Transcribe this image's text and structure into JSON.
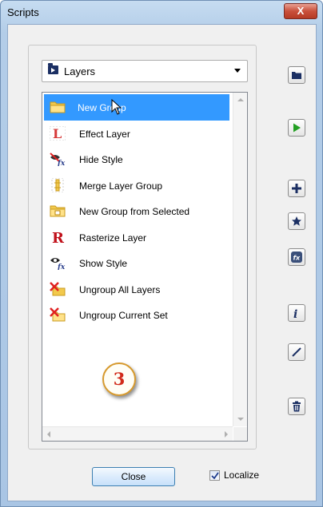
{
  "window": {
    "title": "Scripts",
    "close_glyph": "X"
  },
  "dropdown": {
    "selected": "Layers",
    "icon": "folder-script-icon"
  },
  "script_list": {
    "items": [
      {
        "label": "New Group",
        "icon": "folder-icon",
        "selected": true
      },
      {
        "label": "Effect Layer",
        "icon": "effect-layer-icon"
      },
      {
        "label": "Hide Style",
        "icon": "hide-style-fx-icon"
      },
      {
        "label": "Merge Layer Group",
        "icon": "merge-layer-group-icon"
      },
      {
        "label": "New Group from Selected",
        "icon": "folder-from-selected-icon"
      },
      {
        "label": "Rasterize Layer",
        "icon": "rasterize-r-icon"
      },
      {
        "label": "Show Style",
        "icon": "show-style-eye-fx-icon"
      },
      {
        "label": "Ungroup All Layers",
        "icon": "ungroup-all-icon"
      },
      {
        "label": "Ungroup Current Set",
        "icon": "ungroup-current-icon"
      }
    ]
  },
  "callout": {
    "number": "3"
  },
  "side_buttons": [
    {
      "name": "open-folder-button",
      "icon": "folder-icon"
    },
    {
      "name": "run-script-button",
      "icon": "play-icon"
    },
    {
      "name": "add-script-button",
      "icon": "plus-icon"
    },
    {
      "name": "favorite-button",
      "icon": "star-icon"
    },
    {
      "name": "fx-button",
      "icon": "fx-icon"
    },
    {
      "name": "info-button",
      "icon": "info-icon"
    },
    {
      "name": "edit-button",
      "icon": "pencil-icon"
    },
    {
      "name": "delete-button",
      "icon": "trash-icon"
    }
  ],
  "footer": {
    "close_label": "Close",
    "localize_label": "Localize",
    "localize_checked": true
  },
  "colors": {
    "selection": "#3399ff",
    "title_bar": "#b9d1ea",
    "close_button_red": "#c9503b",
    "callout_text": "#d12a1a"
  }
}
